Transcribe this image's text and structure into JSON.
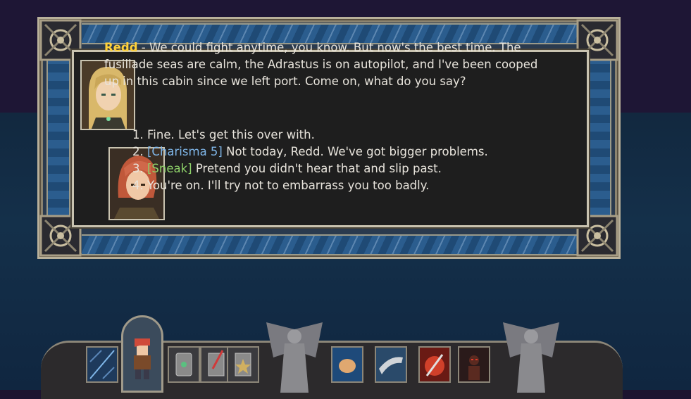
{
  "dialogue": {
    "speaker": "Redd",
    "text": " - We could fight anytime, you know. But now's the best time. The fusillade seas are calm, the Adrastus is on autopilot, and I've been cooped up in this cabin since we left port. Come on, what do you say?",
    "options": [
      {
        "num": "1.",
        "tag": "",
        "text": "Fine. Let's get this over with."
      },
      {
        "num": "2.",
        "tag": "[Charisma 5]",
        "text": " Not today, Redd. We've got bigger problems."
      },
      {
        "num": "3.",
        "tag": "[Sneak]",
        "text": " Pretend you didn't hear that and slip past."
      },
      {
        "num": "4.",
        "tag": "",
        "text": "You're on. I'll try not to embarrass you too badly."
      }
    ]
  },
  "colors": {
    "speaker": "#ffd23a",
    "charisma_tag": "#7fb6e8",
    "sneak_tag": "#8fd36a",
    "text": "#e8e4dc"
  },
  "hotbar": {
    "slots": [
      {
        "icon": "map-icon"
      },
      {
        "icon": "character-portrait-icon"
      },
      {
        "icon": "equipment-icon"
      },
      {
        "icon": "journal-quill-icon"
      },
      {
        "icon": "rank-badge-icon"
      },
      {
        "icon": "fist-punch-icon"
      },
      {
        "icon": "blade-slash-icon"
      },
      {
        "icon": "flaming-dagger-icon"
      },
      {
        "icon": "shadow-figure-icon"
      }
    ]
  }
}
